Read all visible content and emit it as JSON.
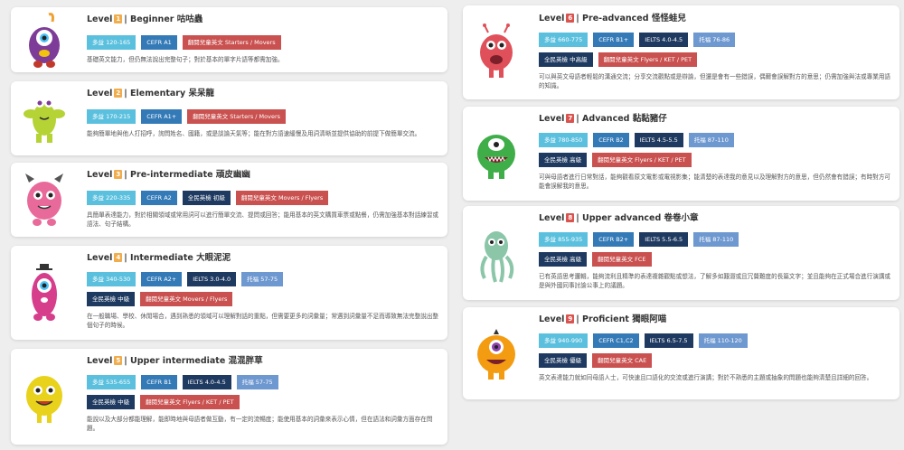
{
  "levels": [
    {
      "num": "1",
      "title": "Beginner 咕咕蟲",
      "tags": [
        {
          "text": "多益 120-165",
          "color": "cyan"
        },
        {
          "text": "CEFR A1",
          "color": "blue"
        },
        {
          "text": "翻閱兒童英文 Starters / Movers",
          "color": "red"
        }
      ],
      "desc": "基礎英文能力，但仍無法說出完整句子；對於基本的單字片語等都需加強。"
    },
    {
      "num": "2",
      "title": "Elementary 呆呆龍",
      "tags": [
        {
          "text": "多益 170-215",
          "color": "cyan"
        },
        {
          "text": "CEFR A1+",
          "color": "blue"
        },
        {
          "text": "翻閱兒童英文 Starters / Movers",
          "color": "red"
        }
      ],
      "desc": "能夠簡單地與他人打招呼，詢問姓名、國籍，或是談論天氣等；能在對方語速緩慢及用詞清晰並提供協助的前提下做簡單交流。"
    },
    {
      "num": "3",
      "title": "Pre-intermediate 頑皮幽幽",
      "tags": [
        {
          "text": "多益 220-335",
          "color": "cyan"
        },
        {
          "text": "CEFR A2",
          "color": "blue"
        },
        {
          "text": "全民英檢 初級",
          "color": "navy"
        },
        {
          "text": "翻閱兒童英文 Movers / Flyers",
          "color": "red"
        }
      ],
      "desc": "具簡單表達能力，對於相關領域或常用詞可以進行簡單交流、提問或回答；能用基本的英文購買車票或點餐，仍需加強基本對話練習或語法、句子結構。"
    },
    {
      "num": "4",
      "title": "Intermediate 大眼泥泥",
      "tags": [
        {
          "text": "多益 340-530",
          "color": "cyan"
        },
        {
          "text": "CEFR A2+",
          "color": "blue"
        },
        {
          "text": "IELTS 3.0-4.0",
          "color": "navy"
        },
        {
          "text": "托福 57-75",
          "color": "sky"
        },
        {
          "text": "全民英檢 中級",
          "color": "navy",
          "brk": true
        },
        {
          "text": "翻閱兒童英文 Movers / Flyers",
          "color": "red"
        }
      ],
      "desc": "在一般職場、學校、休閒場合，遇到熟悉的領域可以理解對話的重點，但需要更多的詞彙量；常遇到詞彙量不足而導致無法完整說出整個句子的時候。"
    },
    {
      "num": "5",
      "title": "Upper intermediate 混混胖草",
      "tags": [
        {
          "text": "多益 535-655",
          "color": "cyan"
        },
        {
          "text": "CEFR B1",
          "color": "blue"
        },
        {
          "text": "IELTS 4.0-4.5",
          "color": "navy"
        },
        {
          "text": "托福 57-75",
          "color": "sky"
        },
        {
          "text": "全民英檢 中級",
          "color": "navy",
          "brk": true
        },
        {
          "text": "翻閱兒童英文 Flyers / KET / PET",
          "color": "red"
        }
      ],
      "desc": "能說以及大部分都能理解，能即時地與母語者做互動，有一定的流暢度；能使用基本的詞彙來表示心情，但在語法和詞彙方面存在問題。"
    },
    {
      "num": "6",
      "title": "Pre-advanced 怪怪蛙兒",
      "tags": [
        {
          "text": "多益 660-775",
          "color": "cyan"
        },
        {
          "text": "CEFR B1+",
          "color": "blue"
        },
        {
          "text": "IELTS 4.0-4.5",
          "color": "navy"
        },
        {
          "text": "托福 76-86",
          "color": "sky"
        },
        {
          "text": "全民英檢 中高級",
          "color": "navy",
          "brk": true
        },
        {
          "text": "翻閱兒童英文 Flyers / KET / PET",
          "color": "red"
        }
      ],
      "desc": "可以與英文母語者輕鬆的溝通交流；分享交流觀點或是辯論，但還是會有一些錯誤，偶爾會誤解對方的意思；仍需加強與法或專業用語的知識。"
    },
    {
      "num": "7",
      "title": "Advanced 黏黏豬仔",
      "tags": [
        {
          "text": "多益 780-850",
          "color": "cyan"
        },
        {
          "text": "CEFR B2",
          "color": "blue"
        },
        {
          "text": "IELTS 4.5-5.5",
          "color": "navy"
        },
        {
          "text": "托福 87-110",
          "color": "sky"
        },
        {
          "text": "全民英檢 高級",
          "color": "navy",
          "brk": true
        },
        {
          "text": "翻閱兒童英文 Flyers / KET / PET",
          "color": "red"
        }
      ],
      "desc": "可與母語者進行日常對話，能夠觀看原文電影或電視影集；能清楚的表達我的意見以及理解對方的意思，但仍然會有錯誤；有時對方可能會誤解我的意思。"
    },
    {
      "num": "8",
      "title": "Upper advanced 卷卷小章",
      "tags": [
        {
          "text": "多益 855-935",
          "color": "cyan"
        },
        {
          "text": "CEFR B2+",
          "color": "blue"
        },
        {
          "text": "IELTS 5.5-6.5",
          "color": "navy"
        },
        {
          "text": "托福 87-110",
          "color": "sky"
        },
        {
          "text": "全民英檢 高級",
          "color": "navy",
          "brk": true
        },
        {
          "text": "翻閱兒童英文 FCE",
          "color": "red"
        }
      ],
      "desc": "已有英語思考邏輯，能夠流利且精準的表達複雜觀點或想法，了解多如艱澀或且冗贅難度的長篇文字；並且能夠在正式場合進行演講或是與外國同事討論公事上的議題。"
    },
    {
      "num": "9",
      "title": "Proficient 獨眼阿喵",
      "tags": [
        {
          "text": "多益 940-990",
          "color": "cyan"
        },
        {
          "text": "CEFR C1,C2",
          "color": "blue"
        },
        {
          "text": "IELTS 6.5-7.5",
          "color": "navy"
        },
        {
          "text": "托福 110-120",
          "color": "sky"
        },
        {
          "text": "全民英檢 優級",
          "color": "navy",
          "brk": true
        },
        {
          "text": "翻閱兒童英文 CAE",
          "color": "red"
        }
      ],
      "desc": "英文表達能力就如同母語人士，可快速且口語化的交流或進行演講；對於不熟悉的主題或抽象的問題也能夠清楚且詳細的回答。"
    }
  ]
}
